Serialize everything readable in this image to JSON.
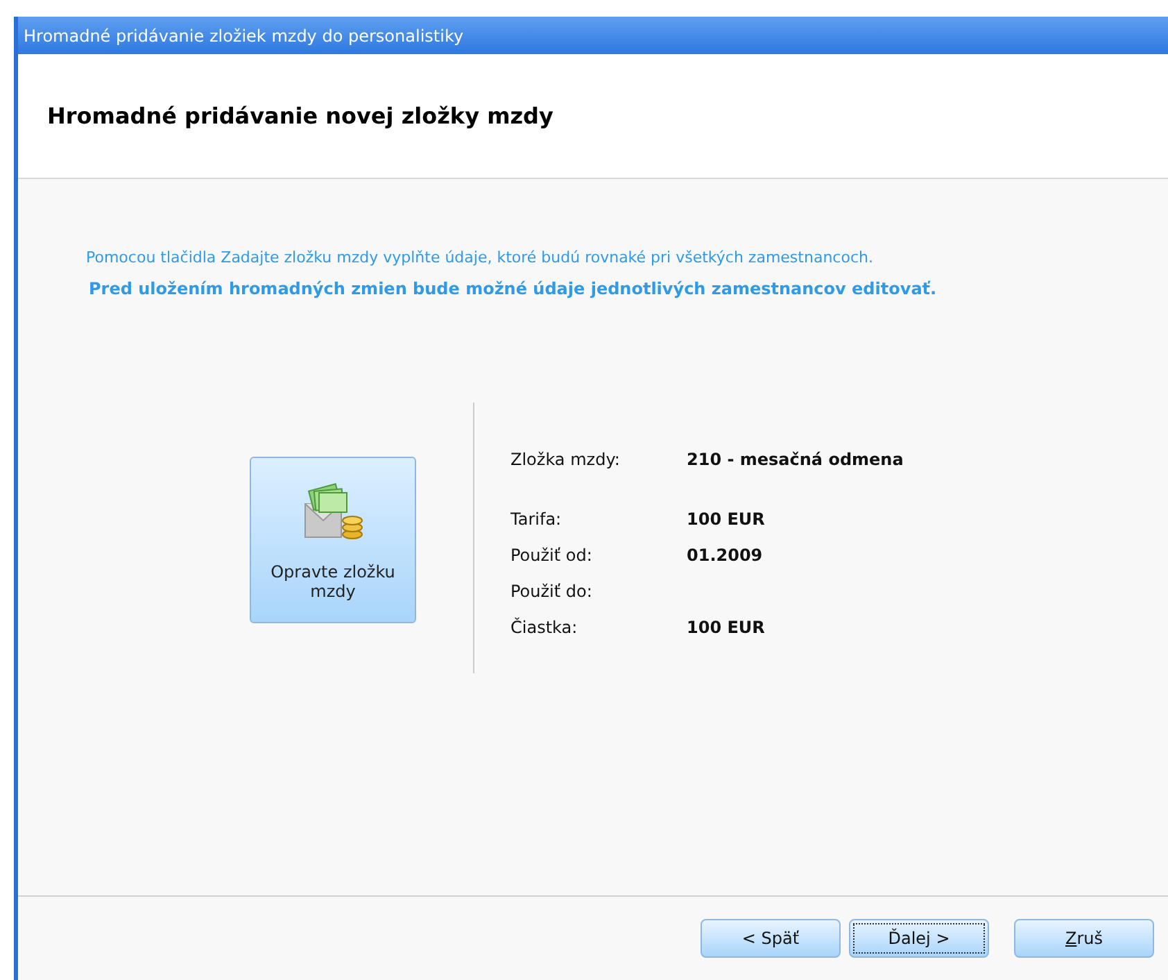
{
  "window": {
    "title": "Hromadné pridávanie zložiek mzdy do personalistiky"
  },
  "header": {
    "title": "Hromadné pridávanie novej zložky mzdy"
  },
  "intro": {
    "line": "Pomocou tlačidla Zadajte zložku mzdy vyplňte údaje, ktoré budú rovnaké pri všetkých zamestnancoch.",
    "emphasis": "Pred uložením hromadných zmien bude možné údaje jednotlivých zamestnancov editovať."
  },
  "edit_button": {
    "label": "Opravte zložku mzdy"
  },
  "fields": [
    {
      "label": "Zložka mzdy:",
      "value": "210 - mesačná odmena"
    },
    {
      "label": "Tarifa:",
      "value": "100 EUR"
    },
    {
      "label": "Použiť od:",
      "value": "01.2009"
    },
    {
      "label": "Použiť do:"
    },
    {
      "label": "Čiastka:",
      "value": "100 EUR"
    }
  ],
  "buttons": [
    {
      "label": "< Späť",
      "focused": false,
      "underline_first": false
    },
    {
      "label": "Ďalej >",
      "focused": true,
      "underline_first": false
    },
    {
      "label": "Zruš",
      "focused": false,
      "underline_first": true
    }
  ]
}
